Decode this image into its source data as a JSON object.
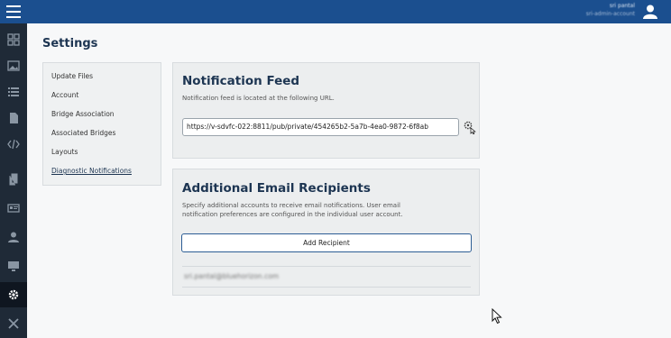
{
  "app": {
    "user_name": "sri pantal",
    "user_account": "sri-admin-account"
  },
  "rail": {
    "icons": [
      "menu-icon",
      "dashboard-icon",
      "image-icon",
      "list-icon",
      "document-icon",
      "code-icon",
      "files-icon",
      "id-card-icon",
      "user-icon",
      "monitor-icon",
      "gear-icon",
      "tools-icon"
    ]
  },
  "page": {
    "title": "Settings"
  },
  "settings_nav": {
    "items": [
      {
        "label": "Update Files"
      },
      {
        "label": "Account"
      },
      {
        "label": "Bridge Association"
      },
      {
        "label": "Associated Bridges"
      },
      {
        "label": "Layouts"
      },
      {
        "label": "Diagnostic Notifications"
      }
    ],
    "active_index": 5
  },
  "notification_feed": {
    "title": "Notification Feed",
    "description": "Notification feed is located at the following URL.",
    "url": "https://v-sdvfc-022:8811/pub/private/454265b2-5a7b-4ea0-9872-6f8ab"
  },
  "email_recipients": {
    "title": "Additional Email Recipients",
    "description_line1": "Specify additional accounts to receive email notifications. User email",
    "description_line2": "notification preferences are configured in the individual user account.",
    "add_button_label": "Add Recipient",
    "recipients": [
      "sri.pantal@bluehorizon.com"
    ]
  },
  "colors": {
    "accent": "#1b4f8f",
    "rail": "#1f2a37",
    "heading": "#1d3552"
  }
}
